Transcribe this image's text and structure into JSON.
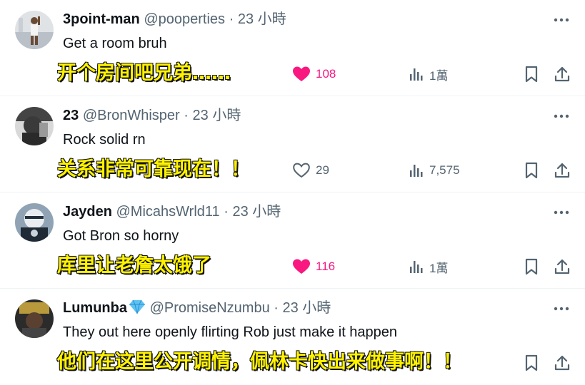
{
  "tweets": [
    {
      "name": "3point-man",
      "handle": "@pooperties",
      "time": "23 小時",
      "text": "Get a room bruh",
      "subtitle": "开个房间吧兄弟……",
      "likes": "108",
      "liked": true,
      "views": "1萬"
    },
    {
      "name": "23",
      "handle": "@BronWhisper",
      "time": "23 小時",
      "text": "Rock solid rn",
      "subtitle": "关系非常可靠现在！！",
      "likes": "29",
      "liked": false,
      "views": "7,575"
    },
    {
      "name": "Jayden",
      "handle": "@MicahsWrld11",
      "time": "23 小時",
      "text": "Got Bron so horny",
      "subtitle": "库里让老詹太饿了",
      "likes": "116",
      "liked": true,
      "views": "1萬"
    },
    {
      "name": "Lumunba",
      "handle": "@PromiseNzumbu",
      "time": "23 小時",
      "text": "They out here openly flirting Rob just make it happen",
      "subtitle": "他们在这里公开调情，佩林卡快出来做事啊！！",
      "likes": "",
      "liked": false,
      "views": ""
    }
  ],
  "separator": "·",
  "colors": {
    "like_active": "#f91880",
    "muted": "#536471",
    "subtitle": "#fff200"
  }
}
